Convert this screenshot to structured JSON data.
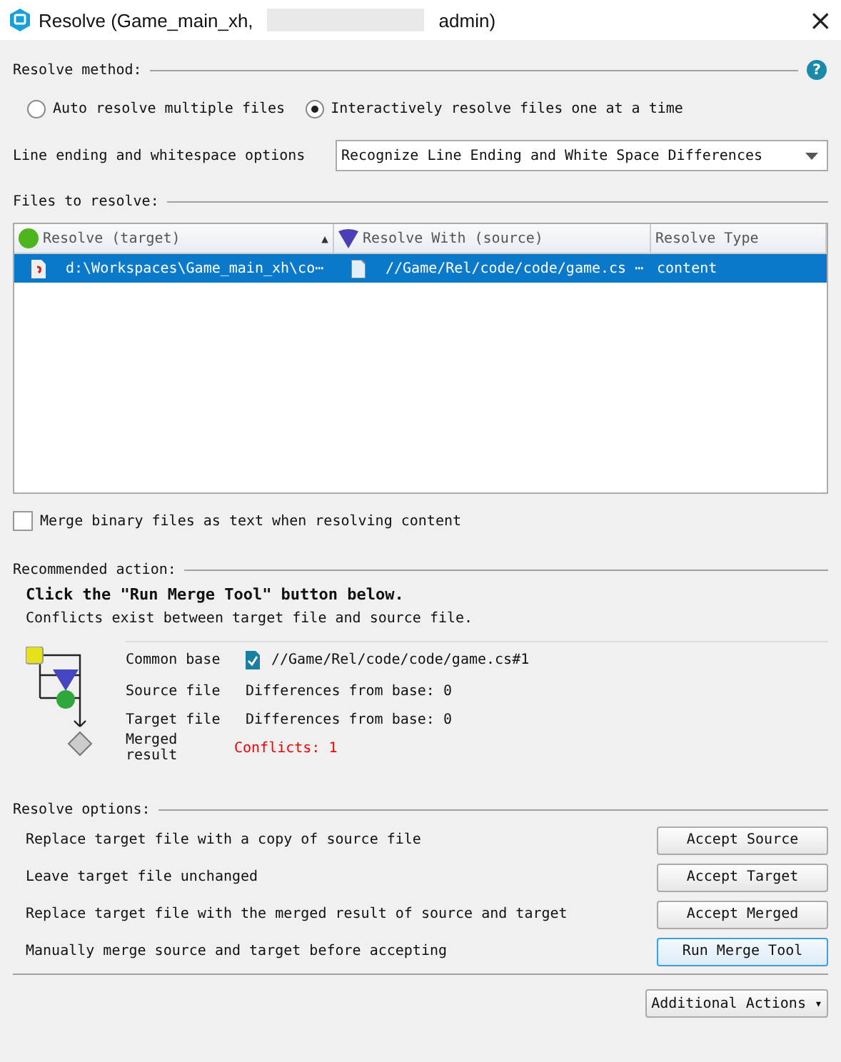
{
  "window": {
    "title_start": "Resolve (Game_main_xh,",
    "title_end": "admin)",
    "close": "×"
  },
  "resolve_method": {
    "label": "Resolve method:",
    "help": "?",
    "options": [
      {
        "label": "Auto resolve multiple files",
        "selected": false
      },
      {
        "label": "Interactively resolve files one at a time",
        "selected": true
      }
    ]
  },
  "line_ending": {
    "label": "Line ending and whitespace options",
    "value": "Recognize Line Ending and White Space Differences"
  },
  "files": {
    "label": "Files to resolve:",
    "columns": [
      "Resolve (target)",
      "Resolve With (source)",
      "Resolve Type"
    ],
    "sort_arrow": "▲",
    "rows": [
      {
        "target": "d:\\Workspaces\\Game_main_xh\\co⋯",
        "source": "//Game/Rel/code/code/game.cs ⋯",
        "type": "content",
        "selected": true
      }
    ]
  },
  "merge_binary": {
    "label": "Merge binary files as text when resolving content",
    "checked": false
  },
  "recommended": {
    "label": "Recommended action:",
    "headline": "Click the \"Run Merge Tool\" button below.",
    "description": "Conflicts exist between target file and source file.",
    "details": [
      {
        "kind": "file",
        "label": "Common base",
        "value": "//Game/Rel/code/code/game.cs#1"
      },
      {
        "kind": "text",
        "label": "Source file",
        "value": "Differences from base: 0"
      },
      {
        "kind": "text",
        "label": "Target file",
        "value": "Differences from base: 0"
      },
      {
        "kind": "conflict",
        "label": "Merged result",
        "value": "Conflicts: 1"
      }
    ]
  },
  "resolve_options": {
    "label": "Resolve options:",
    "rows": [
      {
        "description": "Replace target file with a copy of source file",
        "button": "Accept Source",
        "focused": false
      },
      {
        "description": "Leave target file unchanged",
        "button": "Accept Target",
        "focused": false
      },
      {
        "description": "Replace target file with the merged result of source and target",
        "button": "Accept Merged",
        "focused": false
      },
      {
        "description": "Manually merge source and target before accepting",
        "button": "Run Merge Tool",
        "focused": true
      }
    ]
  },
  "additional_actions": {
    "label": "Additional Actions",
    "caret": "▾"
  }
}
